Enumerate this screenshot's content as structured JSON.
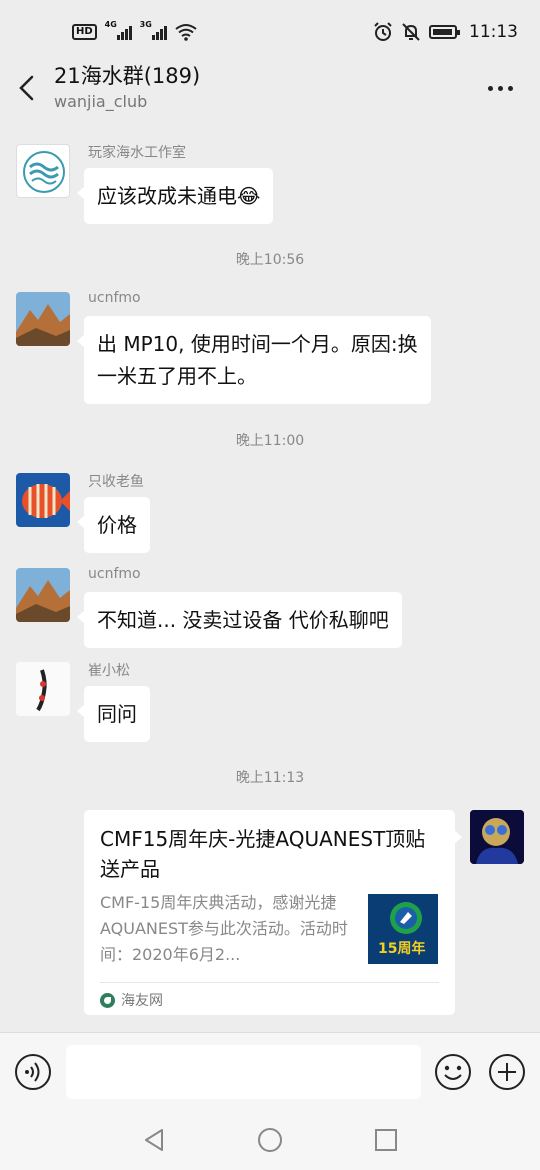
{
  "status_bar": {
    "hd": "HD",
    "net1": "4G",
    "net2": "3G",
    "time": "11:13"
  },
  "header": {
    "title": "21海水群(189)",
    "subtitle": "wanjia_club"
  },
  "messages": [
    {
      "sender": "玩家海水工作室",
      "text": "应该改成未通电😂"
    },
    {
      "sender": "ucnfmo",
      "line1": "出 MP10, 使用时间一个月。原因:换",
      "line2": "一米五了用不上。"
    },
    {
      "sender": "只收老鱼",
      "text": "价格"
    },
    {
      "sender": "ucnfmo",
      "text": "不知道... 没卖过设备  代价私聊吧"
    },
    {
      "sender": "崔小松",
      "text": "同问"
    }
  ],
  "times": [
    "晚上10:56",
    "晚上11:00",
    "晚上11:13"
  ],
  "card": {
    "title": "CMF15周年庆-光捷AQUANEST顶贴送产品",
    "description": "CMF-15周年庆典活动，感谢光捷AQUANEST参与此次活动。活动时间：2020年6月2...",
    "thumb_text": "15周年",
    "source": "海友网"
  },
  "input": {
    "placeholder": ""
  },
  "colors": {
    "background": "#ededed",
    "bubble": "#ffffff",
    "meta_text": "#888888"
  }
}
